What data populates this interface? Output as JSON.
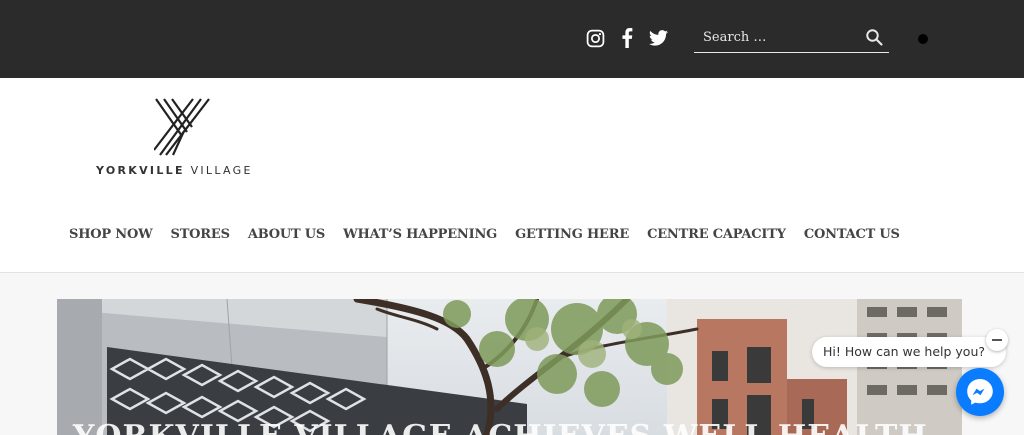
{
  "topbar": {
    "social": [
      {
        "name": "instagram-icon"
      },
      {
        "name": "facebook-icon"
      },
      {
        "name": "twitter-icon"
      }
    ],
    "search": {
      "placeholder": "Search …"
    },
    "colors": {
      "background": "#2b2b2b"
    }
  },
  "logo": {
    "bold": "YORKVILLE",
    "light": "VILLAGE"
  },
  "nav": {
    "items": [
      "SHOP NOW",
      "STORES",
      "ABOUT US",
      "WHAT’S HAPPENING",
      "GETTING HERE",
      "CENTRE CAPACITY",
      "CONTACT US"
    ]
  },
  "hero": {
    "headline": "YORKVILLE VILLAGE ACHIEVES WELL HEALTH"
  },
  "chat": {
    "greeting": "Hi! How can we help you?",
    "brand_color": "#0a7cff"
  }
}
